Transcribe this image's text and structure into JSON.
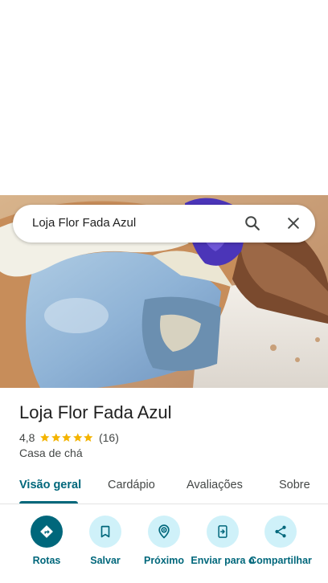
{
  "search": {
    "query": "Loja Flor Fada Azul"
  },
  "place": {
    "name": "Loja Flor Fada Azul",
    "rating": "4,8",
    "stars": 5,
    "review_count": "(16)",
    "category": "Casa de chá"
  },
  "tabs": [
    {
      "label": "Visão geral",
      "active": true
    },
    {
      "label": "Cardápio"
    },
    {
      "label": "Avaliações"
    },
    {
      "label": "Sobre"
    }
  ],
  "actions": [
    {
      "label": "Rotas",
      "icon": "directions-icon"
    },
    {
      "label": "Salvar",
      "icon": "bookmark-icon"
    },
    {
      "label": "Próximo",
      "icon": "nearby-icon"
    },
    {
      "label": "Enviar para o",
      "icon": "send-to-phone-icon"
    },
    {
      "label": "Compartilhar",
      "icon": "share-icon"
    }
  ],
  "colors": {
    "accent": "#00677b",
    "action_bg": "#cff1f9",
    "star": "#f4b400"
  }
}
